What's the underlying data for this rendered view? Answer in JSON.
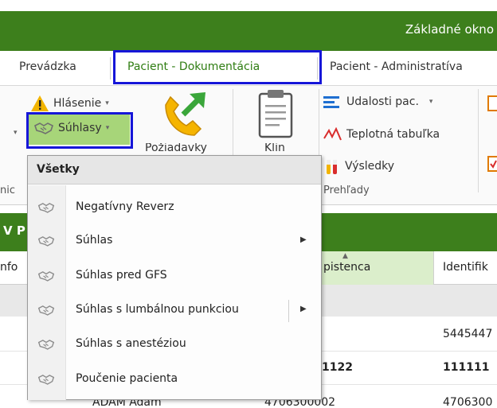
{
  "window": {
    "title": "Základné okno"
  },
  "tabs": [
    {
      "label": "Prevádzka"
    },
    {
      "label": "Pacient - Dokumentácia"
    },
    {
      "label": "Pacient - Administratíva"
    }
  ],
  "ribbon": {
    "hlasenie": "Hlásenie",
    "suhlasy": "Súhlasy",
    "poziadavky": "Požiadavky",
    "klin": "Klin",
    "udalosti": "Udalosti pac.",
    "teplotna": "Teplotná tabuľka",
    "vysledky": "Výsledky",
    "group_left": "nic",
    "group_prehlady": "Prehľady"
  },
  "band": {
    "text": "V P"
  },
  "grid": {
    "columns": [
      "nfo",
      "pistenca",
      "Identifik"
    ],
    "rows": [
      {
        "col2": "",
        "col3": "5445447"
      },
      {
        "col2": "1122",
        "col3": "111111"
      },
      {
        "col1": "ADAM Adam",
        "col2": "4706300002",
        "col3": "4706300"
      }
    ]
  },
  "menu": {
    "header": "Všetky",
    "items": [
      {
        "label": "Negatívny Reverz",
        "submenu": false
      },
      {
        "label": "Súhlas",
        "submenu": true
      },
      {
        "label": "Súhlas pred GFS",
        "submenu": false
      },
      {
        "label": "Súhlas s lumbálnou punkciou",
        "submenu": true
      },
      {
        "label": "Súhlas s anestéziou",
        "submenu": false
      },
      {
        "label": "Poučenie pacienta",
        "submenu": false
      }
    ]
  },
  "colors": {
    "brand_green": "#3d7f1c",
    "highlight_green": "#a7d579",
    "annotation_blue": "#1616d8"
  }
}
